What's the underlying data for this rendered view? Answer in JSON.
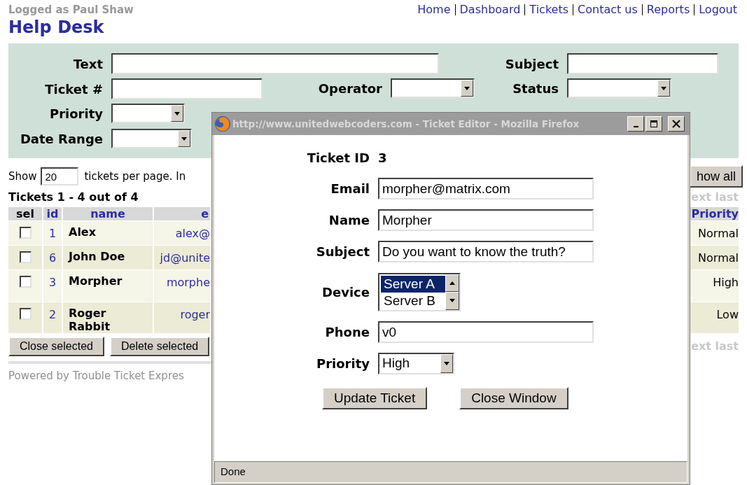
{
  "header": {
    "user": "Logged as Paul Shaw",
    "title": "Help Desk",
    "nav": [
      "Home",
      "Dashboard",
      "Tickets",
      "Contact us",
      "Reports",
      "Logout"
    ]
  },
  "filters": [
    {
      "kind": "text",
      "label": "Text"
    },
    {
      "kind": "text",
      "label": "Subject"
    },
    {
      "kind": "text",
      "label": "Ticket #"
    },
    {
      "kind": "select",
      "label": "Operator"
    },
    {
      "kind": "select",
      "label": "Status"
    },
    {
      "kind": "select",
      "label": "Priority"
    },
    {
      "kind": "select",
      "label": "Date Range"
    }
  ],
  "page_size": {
    "label_before": "Show",
    "value": "20",
    "label_after": "tickets per page. In"
  },
  "show_all_button": "how all",
  "tickets": {
    "caption": "Tickets 1 - 4 out of 4",
    "pager_top": "ext last",
    "pager_bottom": "ext last",
    "columns": [
      "sel",
      "id",
      "name",
      "e",
      "Priority"
    ],
    "rows": [
      {
        "checked": false,
        "id": "1",
        "name": "Alex",
        "email": "alex@",
        "priority": "Normal"
      },
      {
        "checked": false,
        "id": "6",
        "name": "John Doe",
        "email": "jd@unite",
        "priority": "Normal"
      },
      {
        "checked": false,
        "id": "3",
        "name": "Morpher",
        "email": "morphe",
        "priority": "High"
      },
      {
        "checked": false,
        "id": "2",
        "name": "Roger Rabbit",
        "email": "roger",
        "priority": "Low"
      }
    ]
  },
  "buttons": [
    "Close selected",
    "Delete selected"
  ],
  "footer": "Powered by Trouble Ticket Expres",
  "popup": {
    "title": "http://www.unitedwebcoders.com - Ticket Editor - Mozilla Firefox",
    "fields": [
      {
        "kind": "static",
        "label": "Ticket ID",
        "value": "3"
      },
      {
        "kind": "text",
        "label": "Email",
        "value": "morpher@matrix.com"
      },
      {
        "kind": "text",
        "label": "Name",
        "value": "Morpher"
      },
      {
        "kind": "text",
        "label": "Subject",
        "value": "Do you want to know the truth?"
      },
      {
        "kind": "listbox",
        "label": "Device",
        "options": [
          {
            "label": "Server A",
            "selected": true
          },
          {
            "label": "Server B",
            "selected": false
          }
        ]
      },
      {
        "kind": "text",
        "label": "Phone",
        "value": "v0"
      },
      {
        "kind": "select",
        "label": "Priority",
        "value": "High"
      }
    ],
    "buttons": [
      "Update Ticket",
      "Close Window"
    ],
    "status": "Done"
  }
}
